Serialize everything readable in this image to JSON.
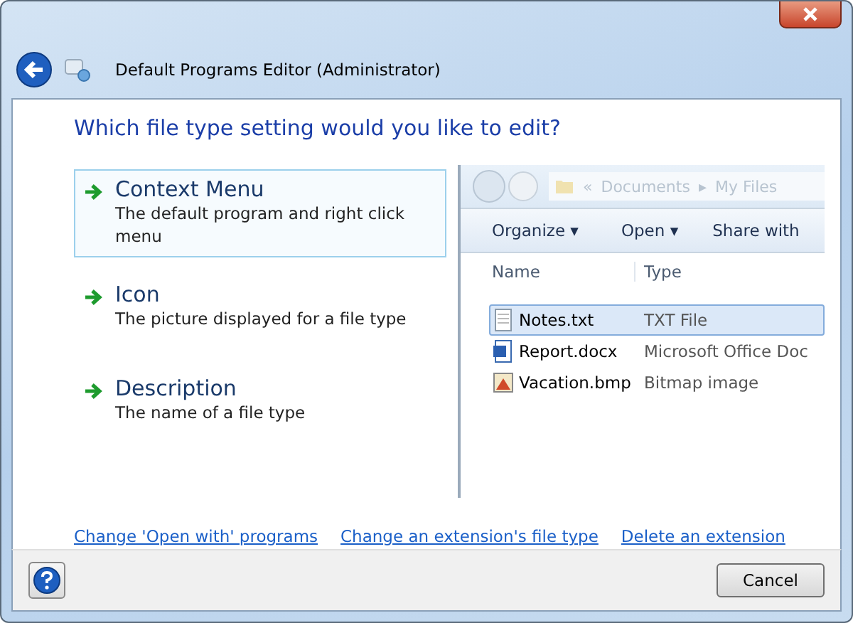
{
  "window": {
    "title": "Default Programs Editor (Administrator)"
  },
  "heading": "Which file type setting would you like to edit?",
  "options": [
    {
      "title": "Context Menu",
      "description": "The default program and right click menu",
      "selected": true
    },
    {
      "title": "Icon",
      "description": "The picture displayed for a file type",
      "selected": false
    },
    {
      "title": "Description",
      "description": "The name of a file type",
      "selected": false
    }
  ],
  "preview": {
    "breadcrumb": [
      "«",
      "Documents",
      "▸",
      "My Files"
    ],
    "toolbar": [
      "Organize ▾",
      "Open ▾",
      "Share with"
    ],
    "columns": [
      "Name",
      "Type"
    ],
    "files": [
      {
        "name": "Notes.txt",
        "type": "TXT File",
        "kind": "text",
        "selected": true
      },
      {
        "name": "Report.docx",
        "type": "Microsoft Office Doc",
        "kind": "word",
        "selected": false
      },
      {
        "name": "Vacation.bmp",
        "type": "Bitmap image",
        "kind": "image",
        "selected": false
      }
    ]
  },
  "links": [
    "Change 'Open with' programs",
    "Change an extension's file type",
    "Delete an extension"
  ],
  "buttons": [
    "Cancel"
  ]
}
